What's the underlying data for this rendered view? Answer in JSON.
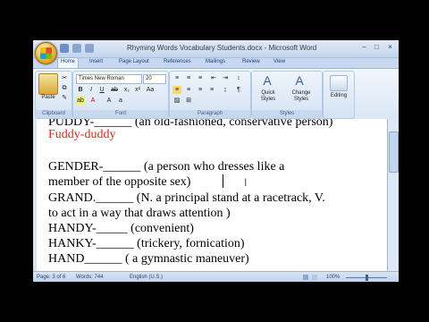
{
  "window": {
    "title": "Rhyming Words Vocabulary Students.docx - Microsoft Word"
  },
  "ribbon": {
    "tabs": [
      "Home",
      "Insert",
      "Page Layout",
      "References",
      "Mailings",
      "Review",
      "View"
    ],
    "active_tab": "Home",
    "clipboard": {
      "label": "Clipboard",
      "paste": "Paste"
    },
    "font": {
      "label": "Font",
      "name": "Times New Roman",
      "size": "20"
    },
    "paragraph": {
      "label": "Paragraph"
    },
    "styles": {
      "label": "Styles",
      "quick": "Quick Styles",
      "change": "Change Styles"
    },
    "editing": {
      "label": "Editing"
    }
  },
  "document": {
    "lines": [
      "PUDDY-______ (an old-fashioned, conservative person)",
      "Fuddy-duddy",
      "",
      "GENDER-______ (a person who dresses like a",
      "member of the opposite sex)",
      "GRAND.______ (N. a principal stand at a racetrack, V.",
      "to act in a way that draws attention )",
      "HANDY-_____ (convenient)",
      "HANKY-______ (trickery, fornication)",
      "HAND______ ( a gymnastic maneuver)"
    ]
  },
  "status": {
    "page": "Page: 3 of 6",
    "words": "Words: 744",
    "language": "English (U.S.)",
    "zoom": "100%",
    "zoom_level": 0.5
  },
  "colors": {
    "answer_text": "#d42a1c",
    "ribbon_blue": "#c7d7ee"
  }
}
